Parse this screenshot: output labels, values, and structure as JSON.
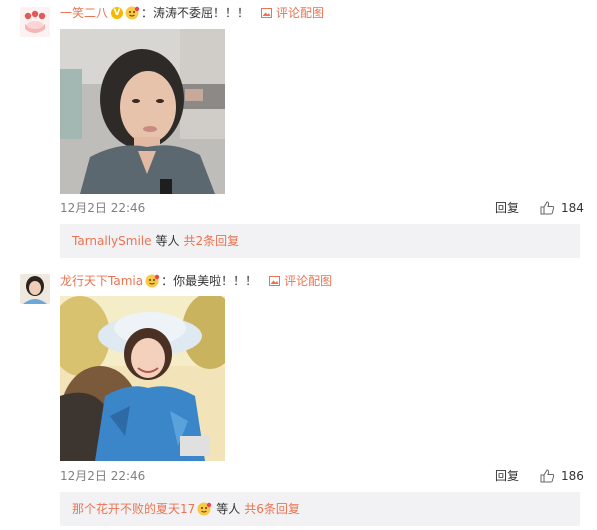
{
  "comments": [
    {
      "username": "一笑二八",
      "verified_badge": "V",
      "text": "：涛涛不委屈！！！",
      "pic_comment_label": "评论配图",
      "time": "12月2日 22:46",
      "reply_label": "回复",
      "like_count": "184",
      "sub_reply": {
        "user": "TarnallySmile",
        "middle": "等人",
        "link": "共2条回复"
      }
    },
    {
      "username": "龙行天下Tamia",
      "text": "：你最美啦！！！",
      "pic_comment_label": "评论配图",
      "time": "12月2日 22:46",
      "reply_label": "回复",
      "like_count": "186",
      "sub_reply": {
        "user": "那个花开不败的夏天17",
        "middle": "等人",
        "link": "共6条回复"
      }
    }
  ],
  "colors": {
    "accent": "#eb7350",
    "sub_box_bg": "#f2f2f5",
    "meta_text": "#808080"
  },
  "icons": {
    "pic": "image-icon",
    "like": "thumbs-up-icon",
    "badge": "emoji-badge-icon"
  }
}
